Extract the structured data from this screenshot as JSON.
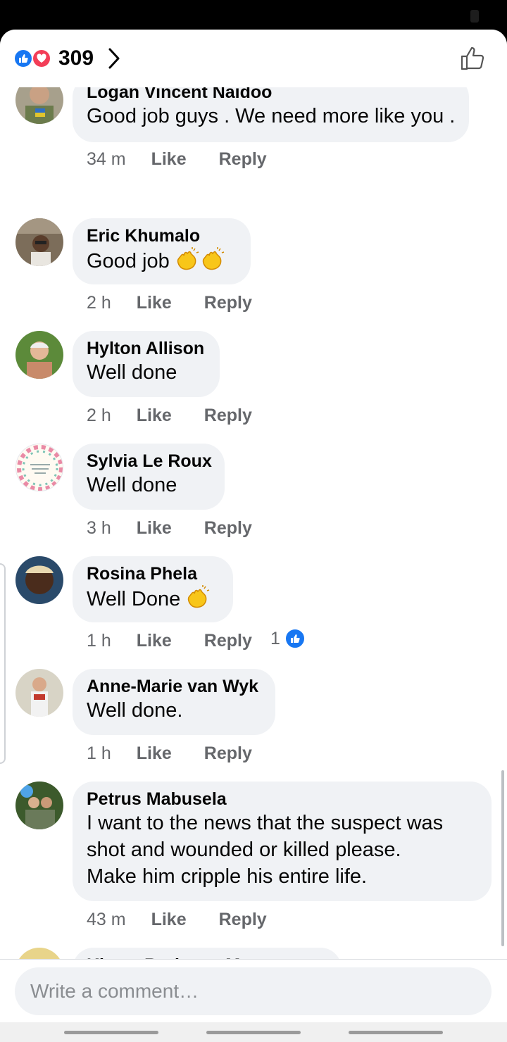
{
  "header": {
    "reaction_count": "309"
  },
  "comments": [
    {
      "author": "Logan Vincent Naidoo",
      "text": "Good job guys . We need more like you .",
      "time": "34 m",
      "like": "Like",
      "reply": "Reply"
    },
    {
      "author": "Eric Khumalo",
      "text": "Good job",
      "time": "2 h",
      "like": "Like",
      "reply": "Reply",
      "emoji": "clapping-hands x2"
    },
    {
      "author": "Hylton Allison",
      "text": "Well done",
      "time": "2 h",
      "like": "Like",
      "reply": "Reply"
    },
    {
      "author": "Sylvia Le Roux",
      "text": "Well done",
      "time": "3 h",
      "like": "Like",
      "reply": "Reply"
    },
    {
      "author": "Rosina Phela",
      "text": "Well Done",
      "time": "1 h",
      "like": "Like",
      "reply": "Reply",
      "likes": "1",
      "emoji": "clapping-hands"
    },
    {
      "author": "Anne-Marie van Wyk",
      "text": "Well done.",
      "time": "1 h",
      "like": "Like",
      "reply": "Reply"
    },
    {
      "author": "Petrus Mabusela",
      "lines": [
        "I want to the news that the suspect was",
        "shot and wounded or killed please.",
        "Make him cripple his entire life."
      ],
      "time": "43 m",
      "like": "Like",
      "reply": "Reply"
    },
    {
      "author": "Khaya Rorisang Manana"
    }
  ],
  "composer": {
    "placeholder": "Write a comment…"
  },
  "colors": {
    "like_blue": "#1877f2",
    "love_red": "#f33e58",
    "bubble_bg": "#f0f2f5",
    "meta_gray": "#65676b"
  }
}
